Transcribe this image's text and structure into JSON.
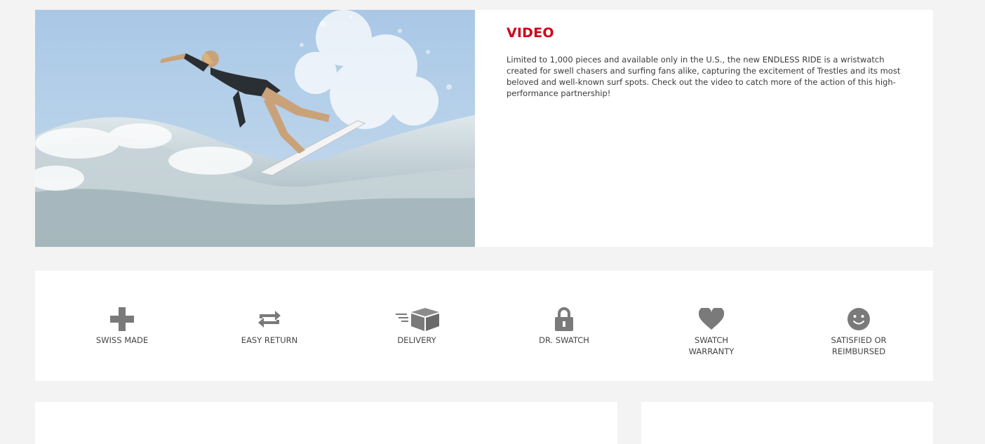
{
  "video": {
    "title": "VIDEO",
    "description": "Limited to 1,000 pieces and available only in the U.S., the new ENDLESS RIDE is a wristwatch created for swell chasers and surfing fans alike, capturing the excitement of Trestles and its most beloved and well-known surf spots. Check out the video to catch more of the action of this high-performance partnership!"
  },
  "features": [
    {
      "icon": "plus-icon",
      "lines": [
        "SWISS MADE"
      ]
    },
    {
      "icon": "return-arrows-icon",
      "lines": [
        "EASY RETURN"
      ]
    },
    {
      "icon": "delivery-box-icon",
      "lines": [
        "DELIVERY"
      ]
    },
    {
      "icon": "lock-icon",
      "lines": [
        "DR. SWATCH"
      ]
    },
    {
      "icon": "heart-icon",
      "lines": [
        "SWATCH",
        "WARRANTY"
      ]
    },
    {
      "icon": "smiley-icon",
      "lines": [
        "SATISFIED OR",
        "REIMBURSED"
      ]
    }
  ],
  "colors": {
    "accent": "#d0021b",
    "icon": "#7a7a7a",
    "background": "#f3f3f3"
  }
}
